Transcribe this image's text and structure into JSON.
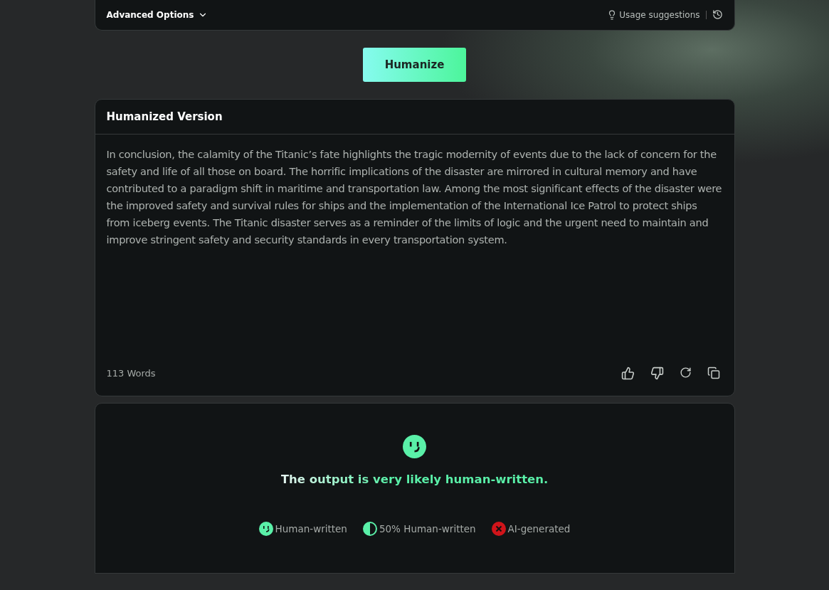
{
  "options_bar": {
    "label": "Advanced Options",
    "suggestions": "Usage suggestions"
  },
  "action": {
    "label": "Humanize"
  },
  "output": {
    "title": "Humanized Version",
    "text": "In conclusion, the calamity of the Titanic’s fate highlights the tragic modernity of events due to the lack of concern for the safety and life of all those on board. The horrific implications of the disaster are mirrored in cultural memory and have contributed to a paradigm shift in maritime and transportation law. Among the most significant effects of the disaster were the improved safety and survival rules for ships and the implementation of the International Ice Patrol to protect ships from iceberg events. The Titanic disaster serves as a reminder of the limits of logic and the urgent need to maintain and improve stringent safety and security standards in every transportation system.",
    "word_count": "113 Words"
  },
  "result": {
    "message": "The output is very likely human-written.",
    "legend": [
      {
        "kind": "human",
        "label": "Human-written",
        "color": "#5af0a8"
      },
      {
        "kind": "half",
        "label": "50% Human-written",
        "color": "#5af0a8"
      },
      {
        "kind": "ai",
        "label": "AI-generated",
        "color": "#d0141a"
      }
    ]
  }
}
